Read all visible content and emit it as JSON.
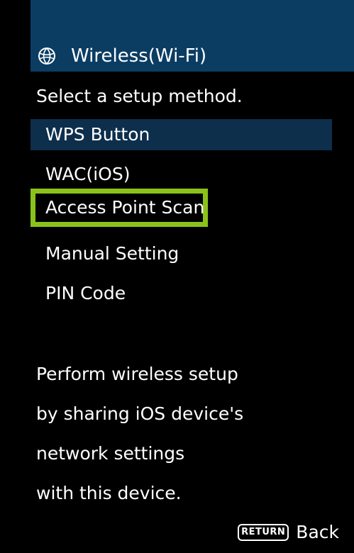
{
  "header": {
    "title": "Wireless(Wi-Fi)",
    "icon": "globe-icon"
  },
  "subtitle": "Select a setup method.",
  "menu": {
    "items": [
      {
        "label": "WPS Button",
        "state": "selected"
      },
      {
        "label": "WAC(iOS)",
        "state": "normal"
      },
      {
        "label": "Access Point Scan",
        "state": "focused"
      },
      {
        "label": "Manual Setting",
        "state": "normal"
      },
      {
        "label": "PIN Code",
        "state": "normal"
      }
    ]
  },
  "description": {
    "lines": [
      "Perform wireless setup",
      "by sharing iOS device's",
      "network settings",
      "with this device."
    ]
  },
  "footer": {
    "key_label": "RETURN",
    "action_label": "Back"
  },
  "colors": {
    "header_bg": "#0b3d63",
    "selected_bg": "#0d2f4c",
    "focus_border": "#8bc21a",
    "background": "#000000",
    "text": "#ffffff"
  }
}
